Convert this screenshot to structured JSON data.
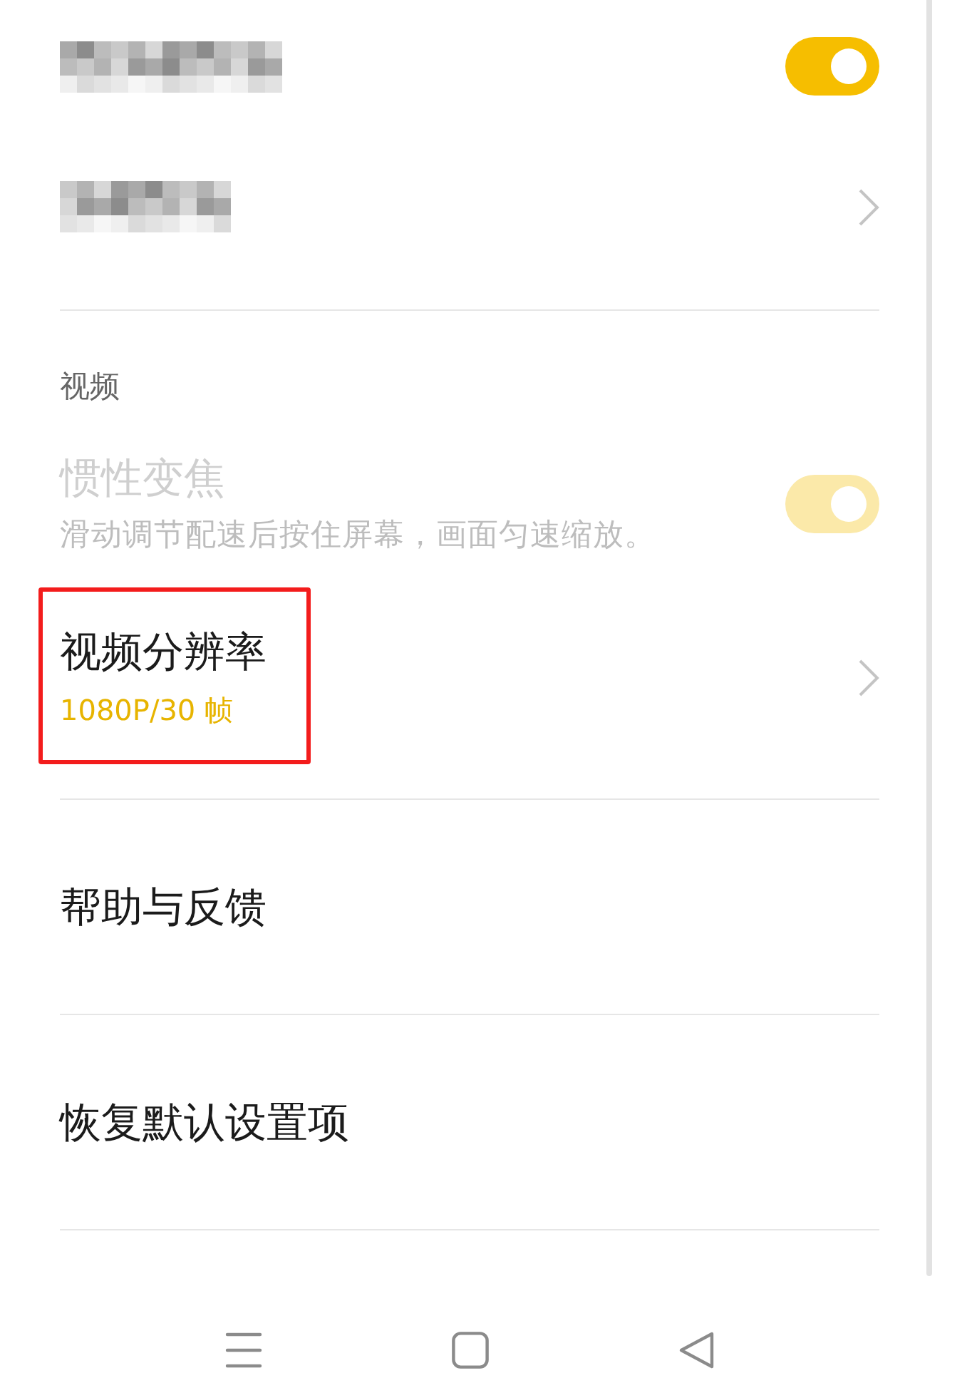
{
  "sections": [
    {
      "rows": [
        {
          "kind": "toggle",
          "redacted": true,
          "on": true,
          "disabled": false,
          "highlighted": false
        },
        {
          "kind": "link",
          "redacted": true,
          "disabled": false,
          "highlighted": false
        }
      ]
    },
    {
      "header": "视频",
      "rows": [
        {
          "kind": "toggle",
          "redacted": false,
          "title": "惯性变焦",
          "subtitle": "滑动调节配速后按住屏幕，画面匀速缩放。",
          "on": true,
          "disabled": true,
          "highlighted": false
        },
        {
          "kind": "link",
          "redacted": false,
          "title": "视频分辨率",
          "value": "1080P/30 帧",
          "disabled": false,
          "highlighted": true
        }
      ]
    },
    {
      "rows": [
        {
          "kind": "action",
          "redacted": false,
          "title": "帮助与反馈",
          "disabled": false,
          "highlighted": false
        }
      ]
    },
    {
      "rows": [
        {
          "kind": "action",
          "redacted": false,
          "title": "恢复默认设置项",
          "disabled": false,
          "highlighted": false
        }
      ]
    }
  ],
  "nav_bar": [
    {
      "kind": "menu"
    },
    {
      "kind": "home"
    },
    {
      "kind": "back"
    }
  ]
}
